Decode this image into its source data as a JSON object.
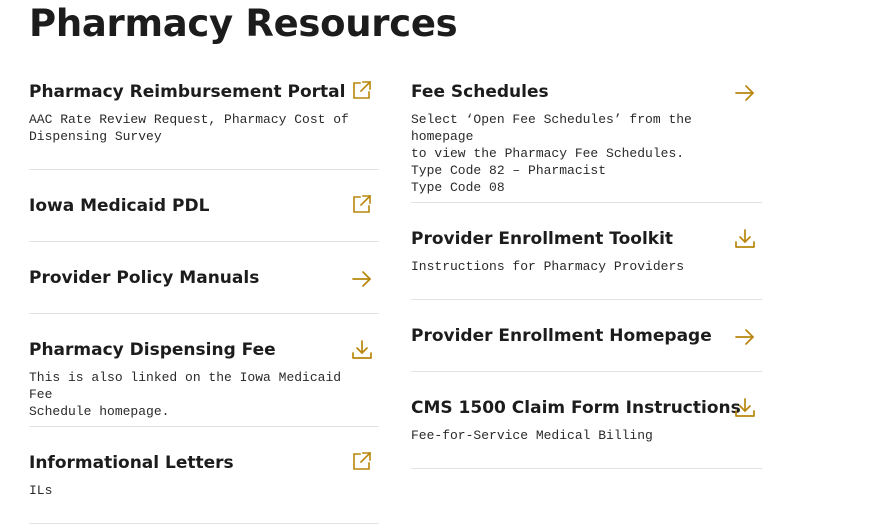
{
  "page": {
    "title": "Pharmacy Resources"
  },
  "colors": {
    "accent": "#b8860b",
    "text": "#1c1c1c",
    "divider": "#e2e2e2"
  },
  "left_column": {
    "items": [
      {
        "title": "Pharmacy Reimbursement Portal",
        "description": "AAC Rate Review Request, Pharmacy Cost of\nDispensing Survey",
        "icon": "external-link-icon"
      },
      {
        "title": "Iowa Medicaid PDL",
        "description": "",
        "icon": "external-link-icon"
      },
      {
        "title": "Provider Policy Manuals",
        "description": "",
        "icon": "arrow-right-icon"
      },
      {
        "title": "Pharmacy Dispensing Fee",
        "description": "This is also linked on the Iowa Medicaid Fee\nSchedule homepage.",
        "icon": "download-icon"
      },
      {
        "title": "Informational Letters",
        "description": "ILs",
        "icon": "external-link-icon"
      }
    ]
  },
  "right_column": {
    "items": [
      {
        "title": "Fee Schedules",
        "description": "Select ‘Open Fee Schedules’ from the homepage\nto view the Pharmacy Fee Schedules.\nType Code 82 – Pharmacist\nType Code 08",
        "icon": "arrow-right-icon"
      },
      {
        "title": "Provider Enrollment Toolkit",
        "description": "Instructions for Pharmacy Providers",
        "icon": "download-icon"
      },
      {
        "title": "Provider Enrollment Homepage",
        "description": "",
        "icon": "arrow-right-icon"
      },
      {
        "title": "CMS 1500 Claim Form Instructions",
        "description": "Fee-for-Service Medical Billing",
        "icon": "download-icon"
      }
    ]
  }
}
